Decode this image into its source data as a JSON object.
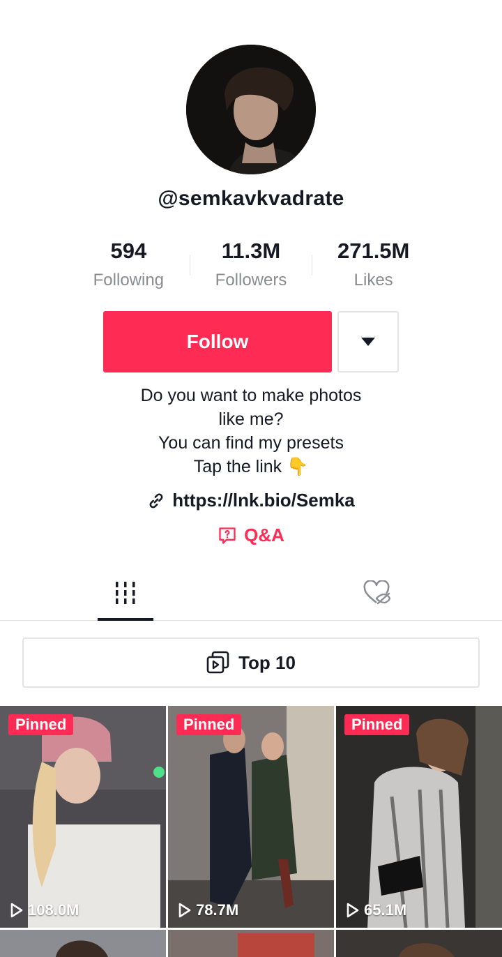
{
  "profile": {
    "username": "@semkavkvadrate",
    "avatar_icon": "profile-photo"
  },
  "stats": [
    {
      "value": "594",
      "label": "Following"
    },
    {
      "value": "11.3M",
      "label": "Followers"
    },
    {
      "value": "271.5M",
      "label": "Likes"
    }
  ],
  "actions": {
    "follow_label": "Follow",
    "more_icon": "caret-down-icon"
  },
  "bio": {
    "line1": "Do you want to make photos",
    "line2": "like me?",
    "line3": "You can find my presets",
    "line4": "Tap the link 👇",
    "link": "https://lnk.bio/Semka",
    "qa_label": "Q&A"
  },
  "tabs": {
    "videos_icon": "grid-bars-icon",
    "liked_icon": "hidden-heart-icon"
  },
  "playlist": {
    "label": "Top 10"
  },
  "videos": [
    {
      "pinned": "Pinned",
      "views": "108.0M"
    },
    {
      "pinned": "Pinned",
      "views": "78.7M"
    },
    {
      "pinned": "Pinned",
      "views": "65.1M"
    }
  ],
  "colors": {
    "accent": "#fe2c55",
    "text": "#161823",
    "muted": "#8a8b91",
    "border": "#e3e3e4"
  }
}
